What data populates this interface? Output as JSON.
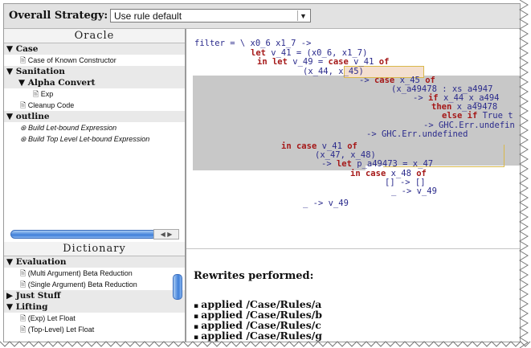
{
  "toolbar": {
    "strategy_label": "Overall Strategy:",
    "strategy_value": "Use rule default"
  },
  "oracle": {
    "title": "Oracle",
    "rows": [
      {
        "kind": "cat",
        "text": "▼ Case"
      },
      {
        "kind": "leaf",
        "text": "🖹 Case of Known Constructor"
      },
      {
        "kind": "cat",
        "text": "▼ Sanitation"
      },
      {
        "kind": "sub",
        "text": "▼ Alpha Convert"
      },
      {
        "kind": "leaf2",
        "text": "🖹 Exp"
      },
      {
        "kind": "leaf",
        "text": "🖹 Cleanup Code"
      },
      {
        "kind": "cat",
        "text": "▼ outline"
      },
      {
        "kind": "leafi",
        "text": "⊛ Build Let-bound Expression"
      },
      {
        "kind": "leafi",
        "text": "⊛ Build Top Level Let-bound Expression"
      }
    ]
  },
  "dictionary": {
    "title": "Dictionary",
    "rows": [
      {
        "kind": "cat",
        "text": "▼ Evaluation"
      },
      {
        "kind": "leaf",
        "text": "🖹 (Multi Argument) Beta Reduction"
      },
      {
        "kind": "leaf",
        "text": "🖹 (Single Argument) Beta Reduction"
      },
      {
        "kind": "cat",
        "text": "▶ Just Stuff"
      },
      {
        "kind": "cat",
        "text": "▼ Lifting"
      },
      {
        "kind": "leaf",
        "text": "🖹 (Exp) Let Float"
      },
      {
        "kind": "leaf",
        "text": "🖹 (Top-Level) Let Float"
      }
    ]
  },
  "code": [
    "filter = \\ x0_6 x1_7 ->",
    "let v_41 = (x0_6, x1_7)",
    "in let v_49 = case v_41 of",
    "(x_44, x_45)",
    "-> case x_45 of",
    "(x_a49478 : xs_a4947",
    "-> if x_44 x_a494",
    "then x_a49478",
    "else if True t",
    "-> GHC.Err.undefin",
    "-> GHC.Err.undefined",
    "in case v_41 of",
    "(x_47, x_48)",
    "-> let p_a49473 = x_47",
    "in case x_48 of",
    "[] -> []",
    "_ -> v_49",
    "_ -> v_49"
  ],
  "rewrites": {
    "title": "Rewrites performed:",
    "items": [
      "applied /Case/Rules/a",
      "applied /Case/Rules/b",
      "applied /Case/Rules/c",
      "applied /Case/Rules/g"
    ]
  },
  "icons": {
    "dropdown": "chevron-down-icon",
    "scroll-left": "arrow-left-icon",
    "scroll-right": "arrow-right-icon"
  }
}
